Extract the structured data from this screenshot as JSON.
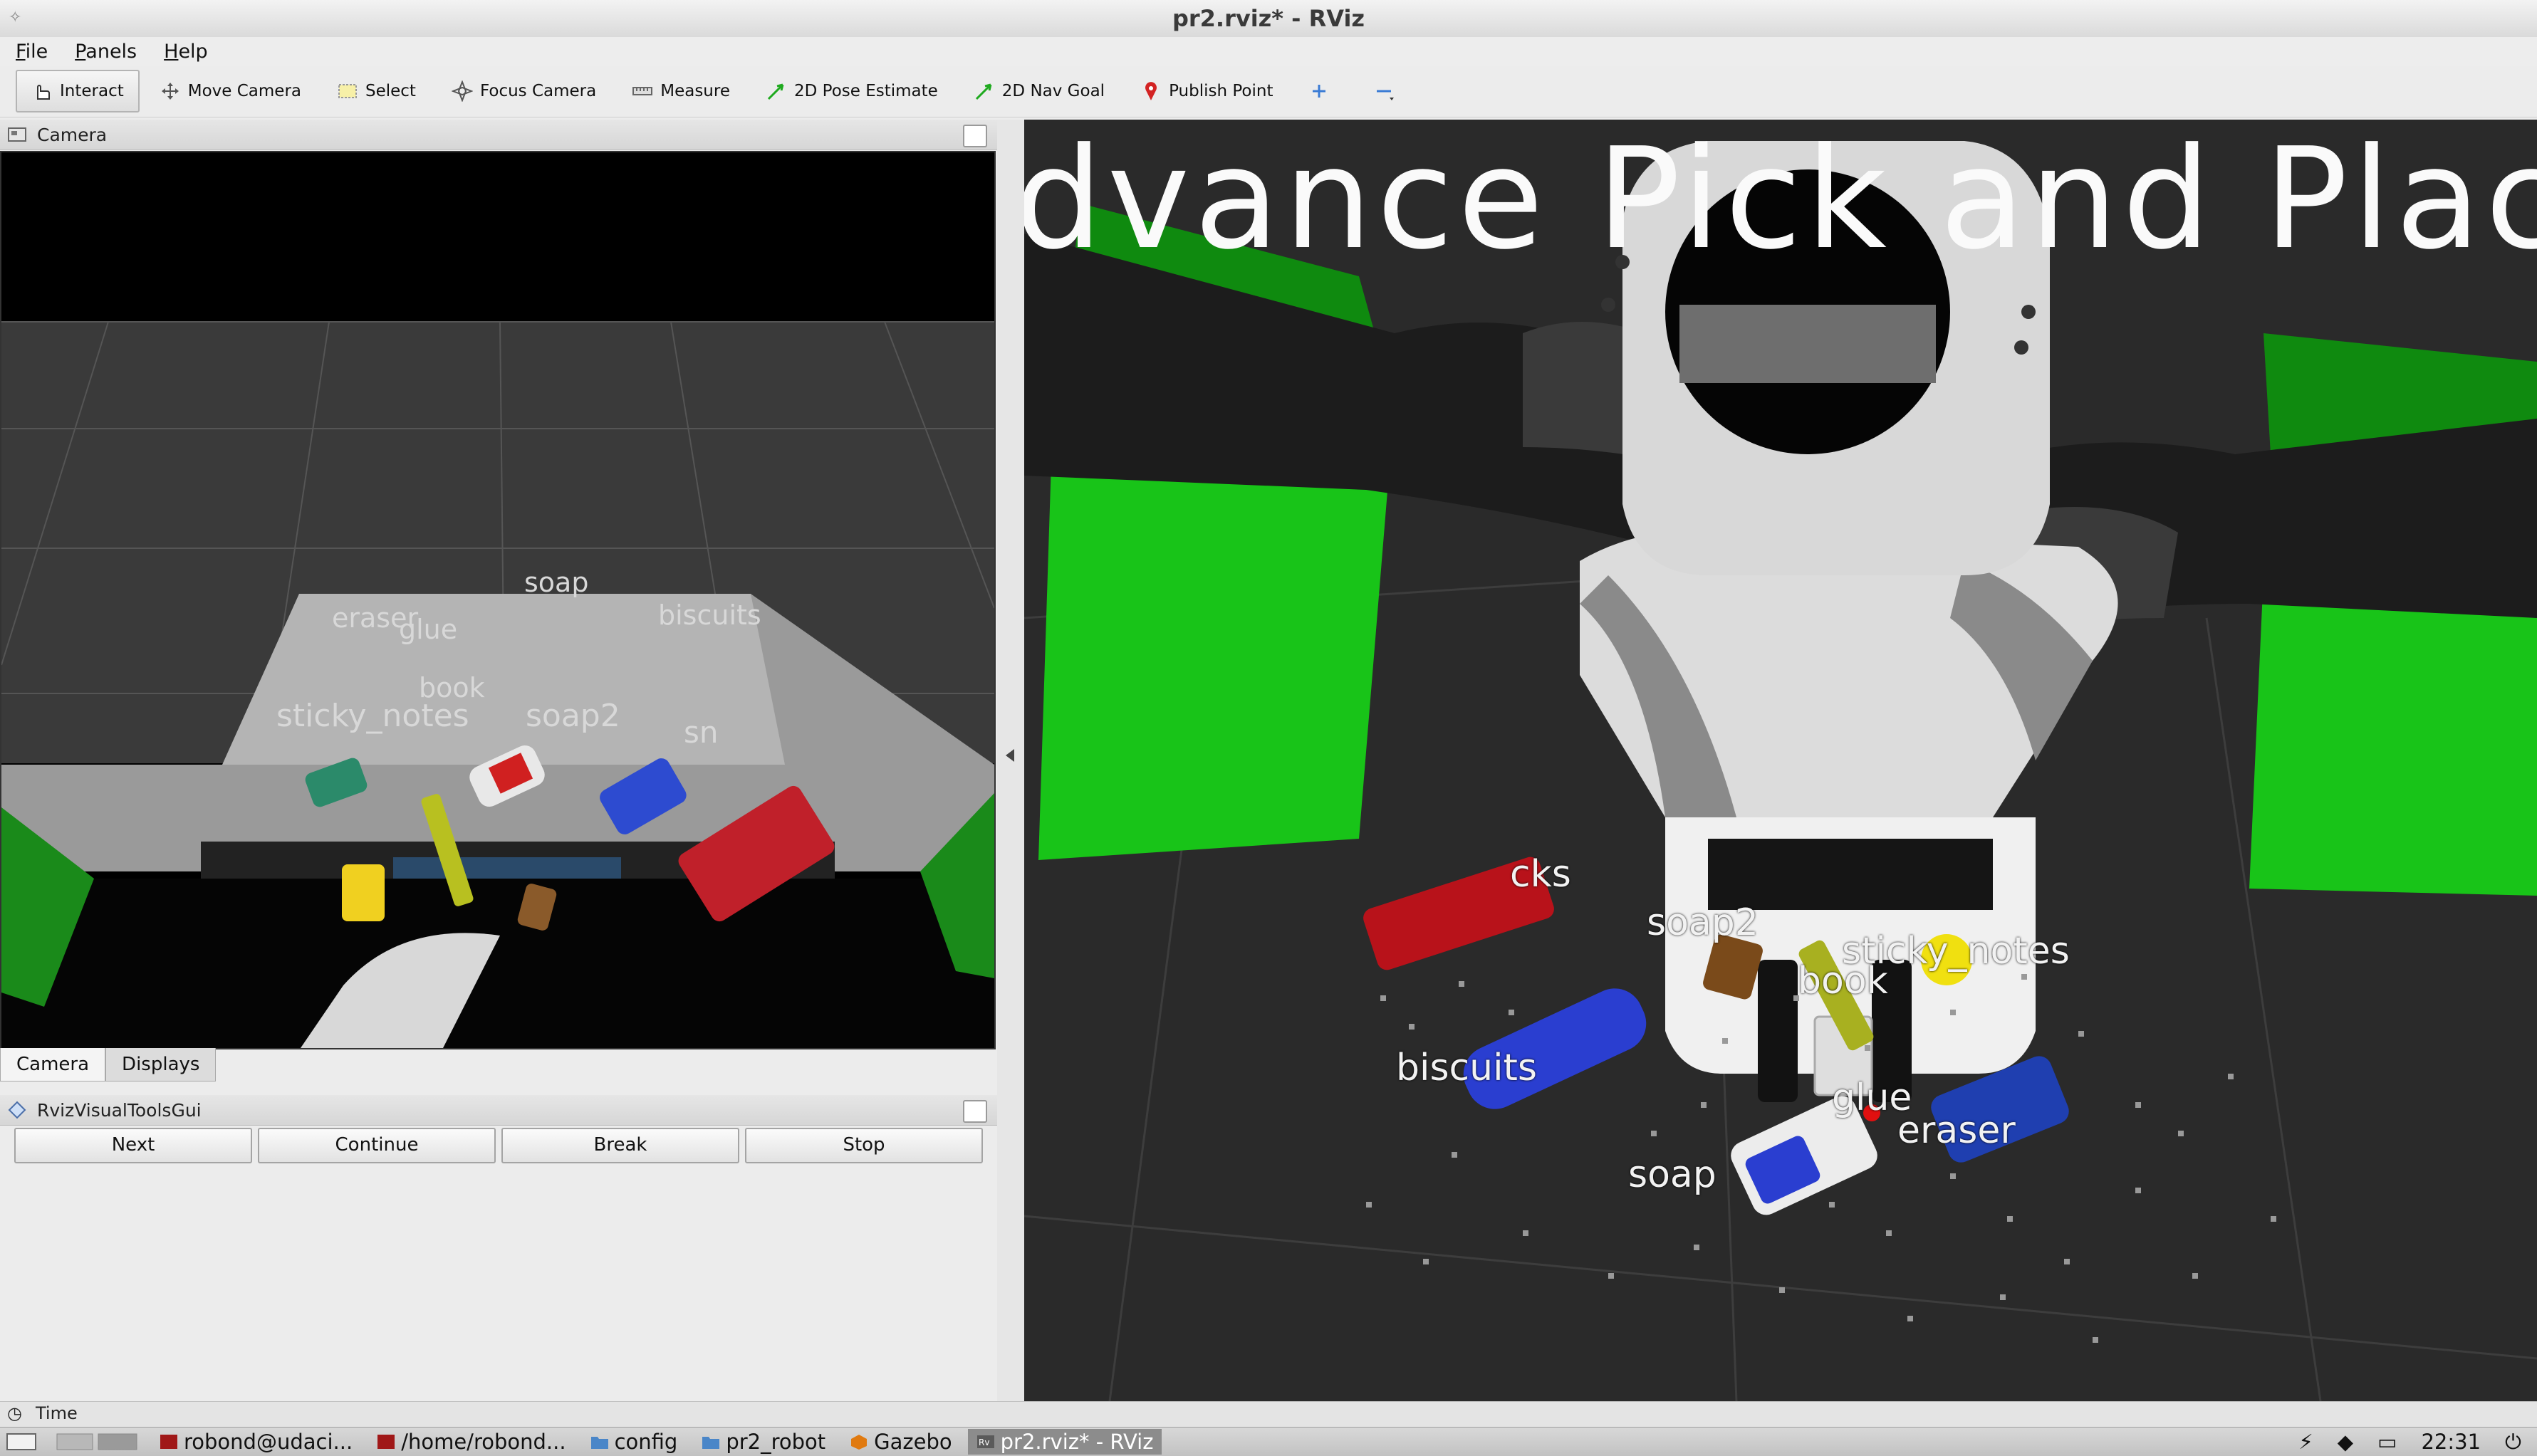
{
  "window": {
    "title": "pr2.rviz* - RViz"
  },
  "menu": [
    "File",
    "Panels",
    "Help"
  ],
  "toolbar": {
    "tools": [
      "Interact",
      "Move Camera",
      "Select",
      "Focus Camera",
      "Measure",
      "2D Pose Estimate",
      "2D Nav Goal",
      "Publish Point"
    ],
    "active": "Interact"
  },
  "camera_panel": {
    "title": "Camera",
    "labels": [
      "eraser",
      "glue",
      "soap",
      "biscuits",
      "book",
      "sticky_notes",
      "soap2",
      "sn"
    ]
  },
  "tabs": [
    "Camera",
    "Displays"
  ],
  "gui_panel": {
    "title": "RvizVisualToolsGui",
    "buttons": [
      "Next",
      "Continue",
      "Break",
      "Stop"
    ]
  },
  "render_view": {
    "overlay_text": "dvance  Pick  and  Place",
    "labels": [
      "cks",
      "soap2",
      "sticky_notes",
      "book",
      "biscuits",
      "glue",
      "eraser",
      "soap"
    ]
  },
  "time_panel": {
    "label": "Time"
  },
  "taskbar": {
    "items": [
      "robond@udaci...",
      "/home/robond...",
      "config",
      "pr2_robot",
      "Gazebo",
      "pr2.rviz* - RViz"
    ],
    "clock": "22:31"
  },
  "colors": {
    "accent_green": "#19c419",
    "background_grid": "#2a2a2a",
    "taskbar_active": "#8c8c8c"
  }
}
